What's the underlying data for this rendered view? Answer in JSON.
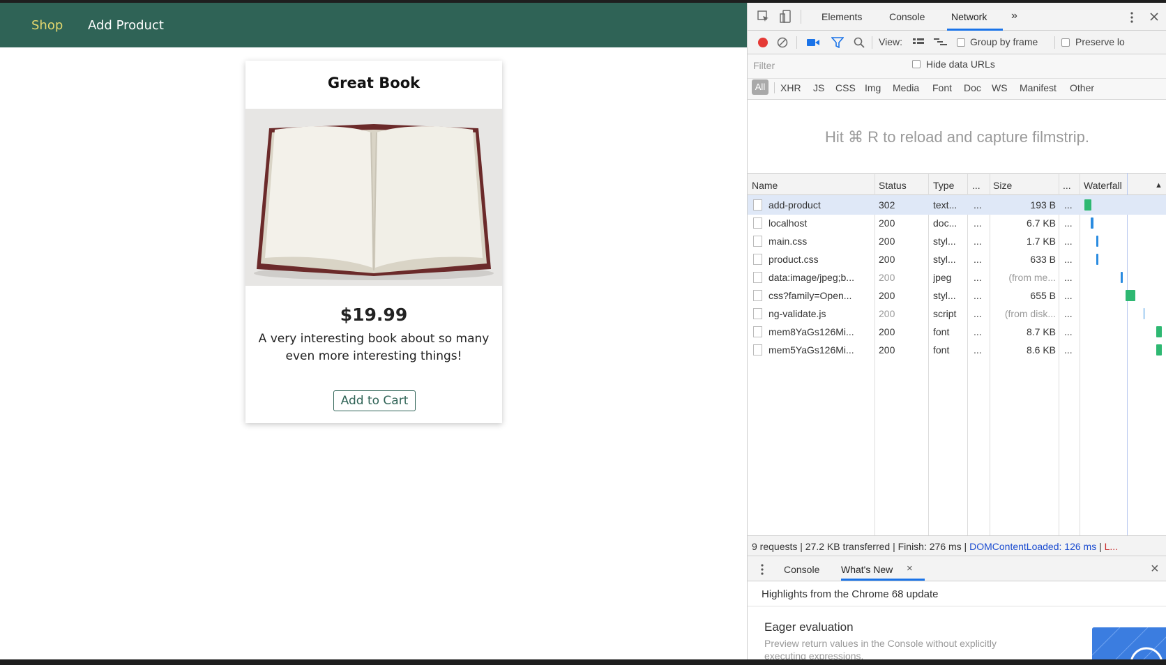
{
  "nav": {
    "shop": "Shop",
    "add_product": "Add Product"
  },
  "product": {
    "title": "Great Book",
    "price": "$19.99",
    "description": "A very interesting book about so many even more interesting things!",
    "add_to_cart": "Add to Cart"
  },
  "devtools": {
    "tabs": {
      "elements": "Elements",
      "console": "Console",
      "network": "Network",
      "more": "»"
    },
    "toolbar": {
      "view": "View:",
      "group_by_frame": "Group by frame",
      "preserve_log": "Preserve lo"
    },
    "filter": {
      "placeholder": "Filter",
      "hide_data_urls": "Hide data URLs"
    },
    "types": {
      "all": "All",
      "xhr": "XHR",
      "js": "JS",
      "css": "CSS",
      "img": "Img",
      "media": "Media",
      "font": "Font",
      "doc": "Doc",
      "ws": "WS",
      "manifest": "Manifest",
      "other": "Other"
    },
    "filmstrip_message": "Hit ⌘ R to reload and capture filmstrip.",
    "columns": {
      "name": "Name",
      "status": "Status",
      "type": "Type",
      "initiator": "...",
      "size": "Size",
      "time": "...",
      "waterfall": "Waterfall",
      "sort": "▲"
    },
    "requests": [
      {
        "name": "add-product",
        "status": "302",
        "type": "text...",
        "init": "...",
        "size": "193 B",
        "time": "...",
        "status_dim": false,
        "size_dim": false
      },
      {
        "name": "localhost",
        "status": "200",
        "type": "doc...",
        "init": "...",
        "size": "6.7 KB",
        "time": "...",
        "status_dim": false,
        "size_dim": false
      },
      {
        "name": "main.css",
        "status": "200",
        "type": "styl...",
        "init": "...",
        "size": "1.7 KB",
        "time": "...",
        "status_dim": false,
        "size_dim": false
      },
      {
        "name": "product.css",
        "status": "200",
        "type": "styl...",
        "init": "...",
        "size": "633 B",
        "time": "...",
        "status_dim": false,
        "size_dim": false
      },
      {
        "name": "data:image/jpeg;b...",
        "status": "200",
        "type": "jpeg",
        "init": "...",
        "size": "(from me...",
        "time": "...",
        "status_dim": true,
        "size_dim": true
      },
      {
        "name": "css?family=Open...",
        "status": "200",
        "type": "styl...",
        "init": "...",
        "size": "655 B",
        "time": "...",
        "status_dim": false,
        "size_dim": false
      },
      {
        "name": "ng-validate.js",
        "status": "200",
        "type": "script",
        "init": "...",
        "size": "(from disk...",
        "time": "...",
        "status_dim": true,
        "size_dim": true
      },
      {
        "name": "mem8YaGs126Mi...",
        "status": "200",
        "type": "font",
        "init": "...",
        "size": "8.7 KB",
        "time": "...",
        "status_dim": false,
        "size_dim": false
      },
      {
        "name": "mem5YaGs126Mi...",
        "status": "200",
        "type": "font",
        "init": "...",
        "size": "8.6 KB",
        "time": "...",
        "status_dim": false,
        "size_dim": false
      }
    ],
    "status_bar": {
      "requests": "9 requests",
      "transferred": "27.2 KB transferred",
      "finish": "Finish: 276 ms",
      "dom_loaded": "DOMContentLoaded: 126 ms",
      "load": "L...",
      "sep": " | "
    },
    "drawer": {
      "tabs": {
        "console": "Console",
        "whats_new": "What's New",
        "close_tab": "×"
      },
      "close": "×",
      "highlights": "Highlights from the Chrome 68 update",
      "eager_title": "Eager evaluation",
      "eager_desc": "Preview return values in the Console without explicitly executing expressions."
    },
    "colors": {
      "record": "#e53935",
      "accent": "#1a73e8",
      "waterfall_green": "#2eb872",
      "waterfall_blue": "#2a8be0"
    }
  }
}
